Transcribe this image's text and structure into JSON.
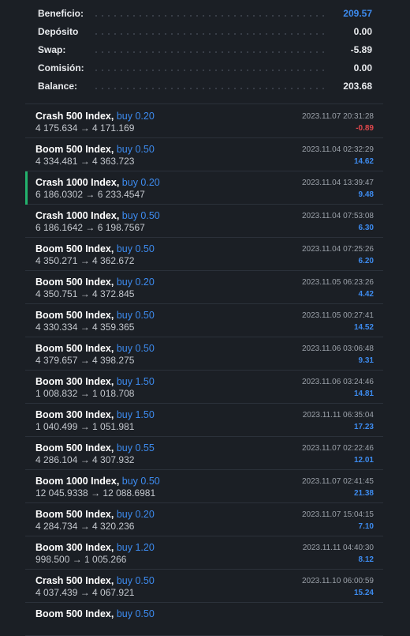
{
  "summary": [
    {
      "label": "Beneficio:",
      "value": "209.57",
      "accent": true
    },
    {
      "label": "Depósito",
      "value": "0.00"
    },
    {
      "label": "Swap:",
      "value": "-5.89"
    },
    {
      "label": "Comisión:",
      "value": "0.00"
    },
    {
      "label": "Balance:",
      "value": "203.68"
    }
  ],
  "deals": [
    {
      "symbol": "Crash 500 Index,",
      "side": "buy 0.20",
      "prices": "4 175.634 → 4 171.169",
      "time": "2023.11.07 20:31:28",
      "profit": "-0.89",
      "negative": true
    },
    {
      "symbol": "Boom 500 Index,",
      "side": "buy 0.50",
      "prices": "4 334.481 → 4 363.723",
      "time": "2023.11.04 02:32:29",
      "profit": "14.62"
    },
    {
      "symbol": "Crash 1000 Index,",
      "side": "buy 0.20",
      "prices": "6 186.0302 → 6 233.4547",
      "time": "2023.11.04 13:39:47",
      "profit": "9.48",
      "selected": true
    },
    {
      "symbol": "Crash 1000 Index,",
      "side": "buy 0.50",
      "prices": "6 186.1642 → 6 198.7567",
      "time": "2023.11.04 07:53:08",
      "profit": "6.30"
    },
    {
      "symbol": "Boom 500 Index,",
      "side": "buy 0.50",
      "prices": "4 350.271 → 4 362.672",
      "time": "2023.11.04 07:25:26",
      "profit": "6.20"
    },
    {
      "symbol": "Boom 500 Index,",
      "side": "buy 0.20",
      "prices": "4 350.751 → 4 372.845",
      "time": "2023.11.05 06:23:26",
      "profit": "4.42"
    },
    {
      "symbol": "Boom 500 Index,",
      "side": "buy 0.50",
      "prices": "4 330.334 → 4 359.365",
      "time": "2023.11.05 00:27:41",
      "profit": "14.52"
    },
    {
      "symbol": "Boom 500 Index,",
      "side": "buy 0.50",
      "prices": "4 379.657 → 4 398.275",
      "time": "2023.11.06 03:06:48",
      "profit": "9.31"
    },
    {
      "symbol": "Boom 300 Index,",
      "side": "buy 1.50",
      "prices": "1 008.832 → 1 018.708",
      "time": "2023.11.06 03:24:46",
      "profit": "14.81"
    },
    {
      "symbol": "Boom 300 Index,",
      "side": "buy 1.50",
      "prices": "1 040.499 → 1 051.981",
      "time": "2023.11.11 06:35:04",
      "profit": "17.23"
    },
    {
      "symbol": "Boom 500 Index,",
      "side": "buy 0.55",
      "prices": "4 286.104 → 4 307.932",
      "time": "2023.11.07 02:22:46",
      "profit": "12.01"
    },
    {
      "symbol": "Boom 1000 Index,",
      "side": "buy 0.50",
      "prices": "12 045.9338 → 12 088.6981",
      "time": "2023.11.07 02:41:45",
      "profit": "21.38"
    },
    {
      "symbol": "Boom 500 Index,",
      "side": "buy 0.20",
      "prices": "4 284.734 → 4 320.236",
      "time": "2023.11.07 15:04:15",
      "profit": "7.10"
    },
    {
      "symbol": "Boom 300 Index,",
      "side": "buy 1.20",
      "prices": "998.500 → 1 005.266",
      "time": "2023.11.11 04:40:30",
      "profit": "8.12"
    },
    {
      "symbol": "Crash 500 Index,",
      "side": "buy 0.50",
      "prices": "4 037.439 → 4 067.921",
      "time": "2023.11.10 06:00:59",
      "profit": "15.24"
    },
    {
      "symbol": "Boom 500 Index,",
      "side": "buy 0.50",
      "prices": "",
      "time": "",
      "profit": ""
    }
  ]
}
